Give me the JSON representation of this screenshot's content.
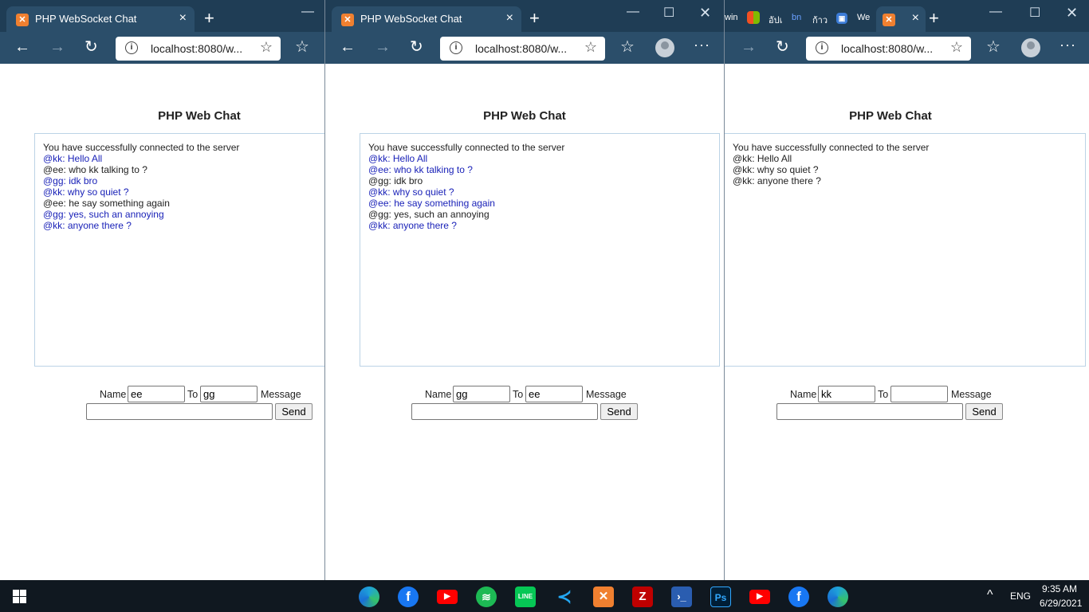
{
  "window1": {
    "tab_title": "PHP WebSocket Chat",
    "url": "localhost:8080/w...",
    "heading": "PHP Web Chat",
    "messages": [
      {
        "text": "You have successfully connected to the server",
        "color": "black"
      },
      {
        "user": "@kk",
        "text": ": Hello All",
        "color": "blue"
      },
      {
        "user": "@ee",
        "text": ": who kk talking to ?",
        "color": "black"
      },
      {
        "user": "@gg",
        "text": ": idk bro",
        "color": "blue"
      },
      {
        "user": "@kk",
        "text": ": why so quiet ?",
        "color": "blue"
      },
      {
        "user": "@ee",
        "text": ": he say something again",
        "color": "black"
      },
      {
        "user": "@gg",
        "text": ": yes, such an annoying",
        "color": "blue"
      },
      {
        "user": "@kk",
        "text": ": anyone there ?",
        "color": "blue"
      }
    ],
    "name_label": "Name",
    "name_value": "ee",
    "to_label": "To",
    "to_value": "gg",
    "message_label": "Message",
    "message_value": "",
    "send_label": "Send"
  },
  "window2": {
    "tab_title": "PHP WebSocket Chat",
    "url": "localhost:8080/w...",
    "heading": "PHP Web Chat",
    "messages": [
      {
        "text": "You have successfully connected to the server",
        "color": "black"
      },
      {
        "user": "@kk",
        "text": ": Hello All",
        "color": "blue"
      },
      {
        "user": "@ee",
        "text": ": who kk talking to ?",
        "color": "blue"
      },
      {
        "user": "@gg",
        "text": ": idk bro",
        "color": "black"
      },
      {
        "user": "@kk",
        "text": ": why so quiet ?",
        "color": "blue"
      },
      {
        "user": "@ee",
        "text": ": he say something again",
        "color": "blue"
      },
      {
        "user": "@gg",
        "text": ": yes, such an annoying",
        "color": "black"
      },
      {
        "user": "@kk",
        "text": ": anyone there ?",
        "color": "blue"
      }
    ],
    "name_label": "Name",
    "name_value": "gg",
    "to_label": "To",
    "to_value": "ee",
    "message_label": "Message",
    "message_value": "",
    "send_label": "Send"
  },
  "window3": {
    "mini_tabs": [
      "win",
      "อัปเ",
      "bn",
      "ก้าว",
      "We"
    ],
    "url": "localhost:8080/w...",
    "heading": "PHP Web Chat",
    "messages": [
      {
        "text": "You have successfully connected to the server",
        "color": "black"
      },
      {
        "user": "@kk",
        "text": ": Hello All",
        "color": "black"
      },
      {
        "user": "@kk",
        "text": ": why so quiet ?",
        "color": "black"
      },
      {
        "user": "@kk",
        "text": ": anyone there ?",
        "color": "black"
      }
    ],
    "name_label": "Name",
    "name_value": "kk",
    "to_label": "To",
    "to_value": "",
    "message_label": "Message",
    "message_value": "",
    "send_label": "Send"
  },
  "taskbar": {
    "language": "ENG",
    "time": "9:35 AM",
    "date": "6/29/2021",
    "apps": [
      "edge",
      "facebook",
      "youtube",
      "spotify",
      "line",
      "vscode",
      "xampp",
      "filezilla",
      "powershell",
      "photoshop",
      "youtube",
      "facebook",
      "edge"
    ],
    "app_labels": {
      "line": "LINE",
      "photoshop": "Ps"
    }
  },
  "colors": {
    "blue_text": "#1a22b8",
    "chrome": "#2b4e6a",
    "tabstrip": "#1f3d55"
  }
}
